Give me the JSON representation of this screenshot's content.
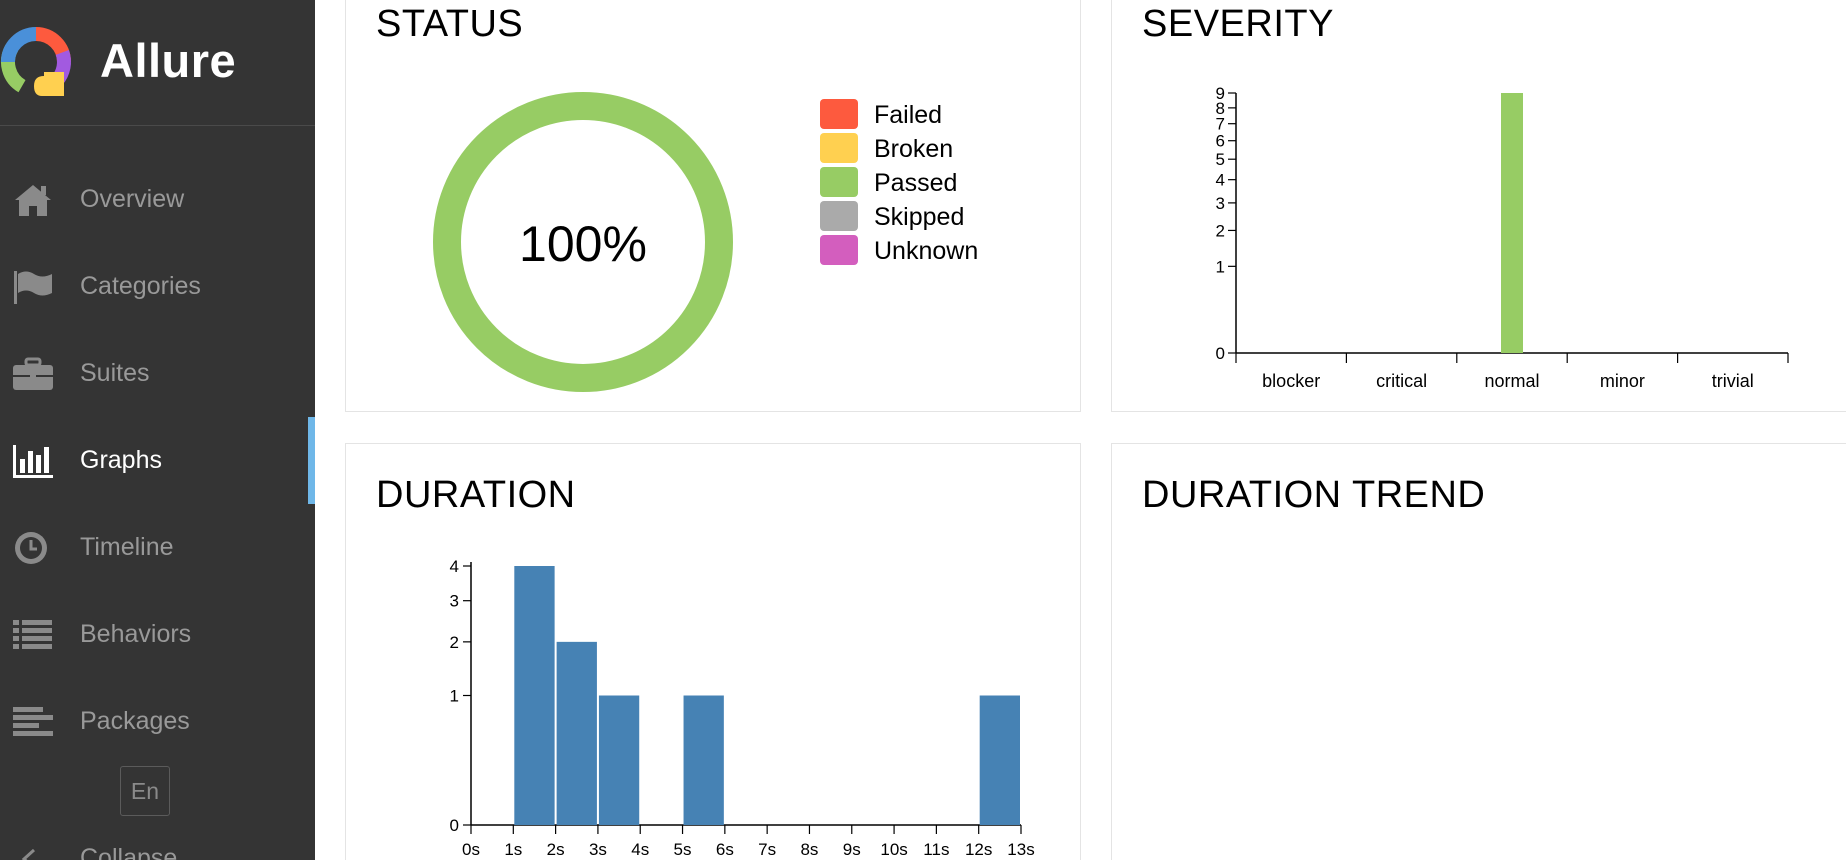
{
  "brand": {
    "name": "Allure"
  },
  "nav": {
    "items": [
      {
        "label": "Overview",
        "icon": "home-icon"
      },
      {
        "label": "Categories",
        "icon": "flag-icon"
      },
      {
        "label": "Suites",
        "icon": "briefcase-icon"
      },
      {
        "label": "Graphs",
        "icon": "bar-chart-icon",
        "active": true
      },
      {
        "label": "Timeline",
        "icon": "clock-icon"
      },
      {
        "label": "Behaviors",
        "icon": "list-icon"
      },
      {
        "label": "Packages",
        "icon": "align-left-icon"
      }
    ],
    "language": "En",
    "collapse": "Collapse"
  },
  "widgets": {
    "status": {
      "title": "STATUS",
      "center_text": "100%",
      "legend": [
        {
          "label": "Failed",
          "color": "#fd5a3e"
        },
        {
          "label": "Broken",
          "color": "#ffd050"
        },
        {
          "label": "Passed",
          "color": "#97cc64"
        },
        {
          "label": "Skipped",
          "color": "#aaaaaa"
        },
        {
          "label": "Unknown",
          "color": "#d35ebe"
        }
      ]
    },
    "severity": {
      "title": "SEVERITY"
    },
    "duration": {
      "title": "DURATION"
    },
    "duration_trend": {
      "title": "DURATION TREND"
    }
  },
  "chart_data": [
    {
      "type": "pie",
      "chart": "status",
      "labels": [
        "Failed",
        "Broken",
        "Passed",
        "Skipped",
        "Unknown"
      ],
      "values": [
        0,
        0,
        9,
        0,
        0
      ],
      "colors": [
        "#fd5a3e",
        "#ffd050",
        "#97cc64",
        "#aaaaaa",
        "#d35ebe"
      ],
      "center_label": "100%"
    },
    {
      "type": "bar",
      "chart": "severity",
      "categories": [
        "blocker",
        "critical",
        "normal",
        "minor",
        "trivial"
      ],
      "values": [
        0,
        0,
        9,
        0,
        0
      ],
      "color": "#97cc64",
      "yticks": [
        0,
        1,
        2,
        3,
        4,
        5,
        6,
        7,
        8,
        9
      ],
      "yscale": "sqrt",
      "ylim": [
        0,
        9
      ]
    },
    {
      "type": "bar",
      "chart": "duration",
      "bins": [
        {
          "x0": 1,
          "x1": 2,
          "value": 4
        },
        {
          "x0": 2,
          "x1": 3,
          "value": 2
        },
        {
          "x0": 3,
          "x1": 4,
          "value": 1
        },
        {
          "x0": 5,
          "x1": 6,
          "value": 1
        },
        {
          "x0": 12,
          "x1": 13,
          "value": 1
        }
      ],
      "color": "#4682b4",
      "xticks": [
        "0s",
        "1s",
        "2s",
        "3s",
        "4s",
        "5s",
        "6s",
        "7s",
        "8s",
        "9s",
        "10s",
        "11s",
        "12s",
        "13s"
      ],
      "xlim": [
        0,
        13
      ],
      "yticks": [
        0,
        1,
        2,
        3,
        4
      ],
      "yscale": "sqrt",
      "ylim": [
        0,
        4
      ]
    }
  ]
}
